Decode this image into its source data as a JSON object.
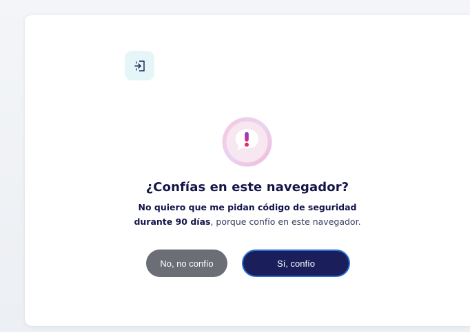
{
  "dialog": {
    "title": "¿Confías en este navegador?",
    "description_bold": "No quiero que me pidan código de seguridad durante 90 días",
    "description_rest": ", porque confío en este navegador.",
    "no_button_label": "No, no confío",
    "yes_button_label": "Sí, confío"
  },
  "icons": {
    "top_button": "logout-door-icon",
    "alert": "exclamation-chat-icon"
  },
  "colors": {
    "title_text": "#13144a",
    "primary_button": "#1a1f5b",
    "primary_button_border": "#2e6fd6",
    "secondary_button": "#6b6f75",
    "icon_button_bg": "#e6f6f8",
    "alert_accent": "#e1306c"
  }
}
